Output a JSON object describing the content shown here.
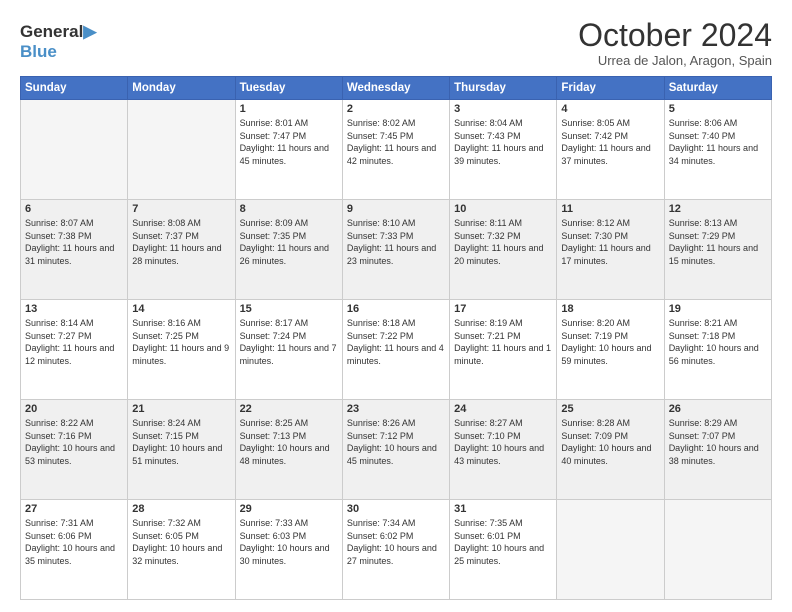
{
  "logo": {
    "line1": "General",
    "line2": "Blue"
  },
  "header": {
    "month": "October 2024",
    "location": "Urrea de Jalon, Aragon, Spain"
  },
  "days_of_week": [
    "Sunday",
    "Monday",
    "Tuesday",
    "Wednesday",
    "Thursday",
    "Friday",
    "Saturday"
  ],
  "weeks": [
    [
      {
        "day": "",
        "info": ""
      },
      {
        "day": "",
        "info": ""
      },
      {
        "day": "1",
        "info": "Sunrise: 8:01 AM\nSunset: 7:47 PM\nDaylight: 11 hours and 45 minutes."
      },
      {
        "day": "2",
        "info": "Sunrise: 8:02 AM\nSunset: 7:45 PM\nDaylight: 11 hours and 42 minutes."
      },
      {
        "day": "3",
        "info": "Sunrise: 8:04 AM\nSunset: 7:43 PM\nDaylight: 11 hours and 39 minutes."
      },
      {
        "day": "4",
        "info": "Sunrise: 8:05 AM\nSunset: 7:42 PM\nDaylight: 11 hours and 37 minutes."
      },
      {
        "day": "5",
        "info": "Sunrise: 8:06 AM\nSunset: 7:40 PM\nDaylight: 11 hours and 34 minutes."
      }
    ],
    [
      {
        "day": "6",
        "info": "Sunrise: 8:07 AM\nSunset: 7:38 PM\nDaylight: 11 hours and 31 minutes."
      },
      {
        "day": "7",
        "info": "Sunrise: 8:08 AM\nSunset: 7:37 PM\nDaylight: 11 hours and 28 minutes."
      },
      {
        "day": "8",
        "info": "Sunrise: 8:09 AM\nSunset: 7:35 PM\nDaylight: 11 hours and 26 minutes."
      },
      {
        "day": "9",
        "info": "Sunrise: 8:10 AM\nSunset: 7:33 PM\nDaylight: 11 hours and 23 minutes."
      },
      {
        "day": "10",
        "info": "Sunrise: 8:11 AM\nSunset: 7:32 PM\nDaylight: 11 hours and 20 minutes."
      },
      {
        "day": "11",
        "info": "Sunrise: 8:12 AM\nSunset: 7:30 PM\nDaylight: 11 hours and 17 minutes."
      },
      {
        "day": "12",
        "info": "Sunrise: 8:13 AM\nSunset: 7:29 PM\nDaylight: 11 hours and 15 minutes."
      }
    ],
    [
      {
        "day": "13",
        "info": "Sunrise: 8:14 AM\nSunset: 7:27 PM\nDaylight: 11 hours and 12 minutes."
      },
      {
        "day": "14",
        "info": "Sunrise: 8:16 AM\nSunset: 7:25 PM\nDaylight: 11 hours and 9 minutes."
      },
      {
        "day": "15",
        "info": "Sunrise: 8:17 AM\nSunset: 7:24 PM\nDaylight: 11 hours and 7 minutes."
      },
      {
        "day": "16",
        "info": "Sunrise: 8:18 AM\nSunset: 7:22 PM\nDaylight: 11 hours and 4 minutes."
      },
      {
        "day": "17",
        "info": "Sunrise: 8:19 AM\nSunset: 7:21 PM\nDaylight: 11 hours and 1 minute."
      },
      {
        "day": "18",
        "info": "Sunrise: 8:20 AM\nSunset: 7:19 PM\nDaylight: 10 hours and 59 minutes."
      },
      {
        "day": "19",
        "info": "Sunrise: 8:21 AM\nSunset: 7:18 PM\nDaylight: 10 hours and 56 minutes."
      }
    ],
    [
      {
        "day": "20",
        "info": "Sunrise: 8:22 AM\nSunset: 7:16 PM\nDaylight: 10 hours and 53 minutes."
      },
      {
        "day": "21",
        "info": "Sunrise: 8:24 AM\nSunset: 7:15 PM\nDaylight: 10 hours and 51 minutes."
      },
      {
        "day": "22",
        "info": "Sunrise: 8:25 AM\nSunset: 7:13 PM\nDaylight: 10 hours and 48 minutes."
      },
      {
        "day": "23",
        "info": "Sunrise: 8:26 AM\nSunset: 7:12 PM\nDaylight: 10 hours and 45 minutes."
      },
      {
        "day": "24",
        "info": "Sunrise: 8:27 AM\nSunset: 7:10 PM\nDaylight: 10 hours and 43 minutes."
      },
      {
        "day": "25",
        "info": "Sunrise: 8:28 AM\nSunset: 7:09 PM\nDaylight: 10 hours and 40 minutes."
      },
      {
        "day": "26",
        "info": "Sunrise: 8:29 AM\nSunset: 7:07 PM\nDaylight: 10 hours and 38 minutes."
      }
    ],
    [
      {
        "day": "27",
        "info": "Sunrise: 7:31 AM\nSunset: 6:06 PM\nDaylight: 10 hours and 35 minutes."
      },
      {
        "day": "28",
        "info": "Sunrise: 7:32 AM\nSunset: 6:05 PM\nDaylight: 10 hours and 32 minutes."
      },
      {
        "day": "29",
        "info": "Sunrise: 7:33 AM\nSunset: 6:03 PM\nDaylight: 10 hours and 30 minutes."
      },
      {
        "day": "30",
        "info": "Sunrise: 7:34 AM\nSunset: 6:02 PM\nDaylight: 10 hours and 27 minutes."
      },
      {
        "day": "31",
        "info": "Sunrise: 7:35 AM\nSunset: 6:01 PM\nDaylight: 10 hours and 25 minutes."
      },
      {
        "day": "",
        "info": ""
      },
      {
        "day": "",
        "info": ""
      }
    ]
  ],
  "shaded_rows": [
    1,
    3
  ]
}
